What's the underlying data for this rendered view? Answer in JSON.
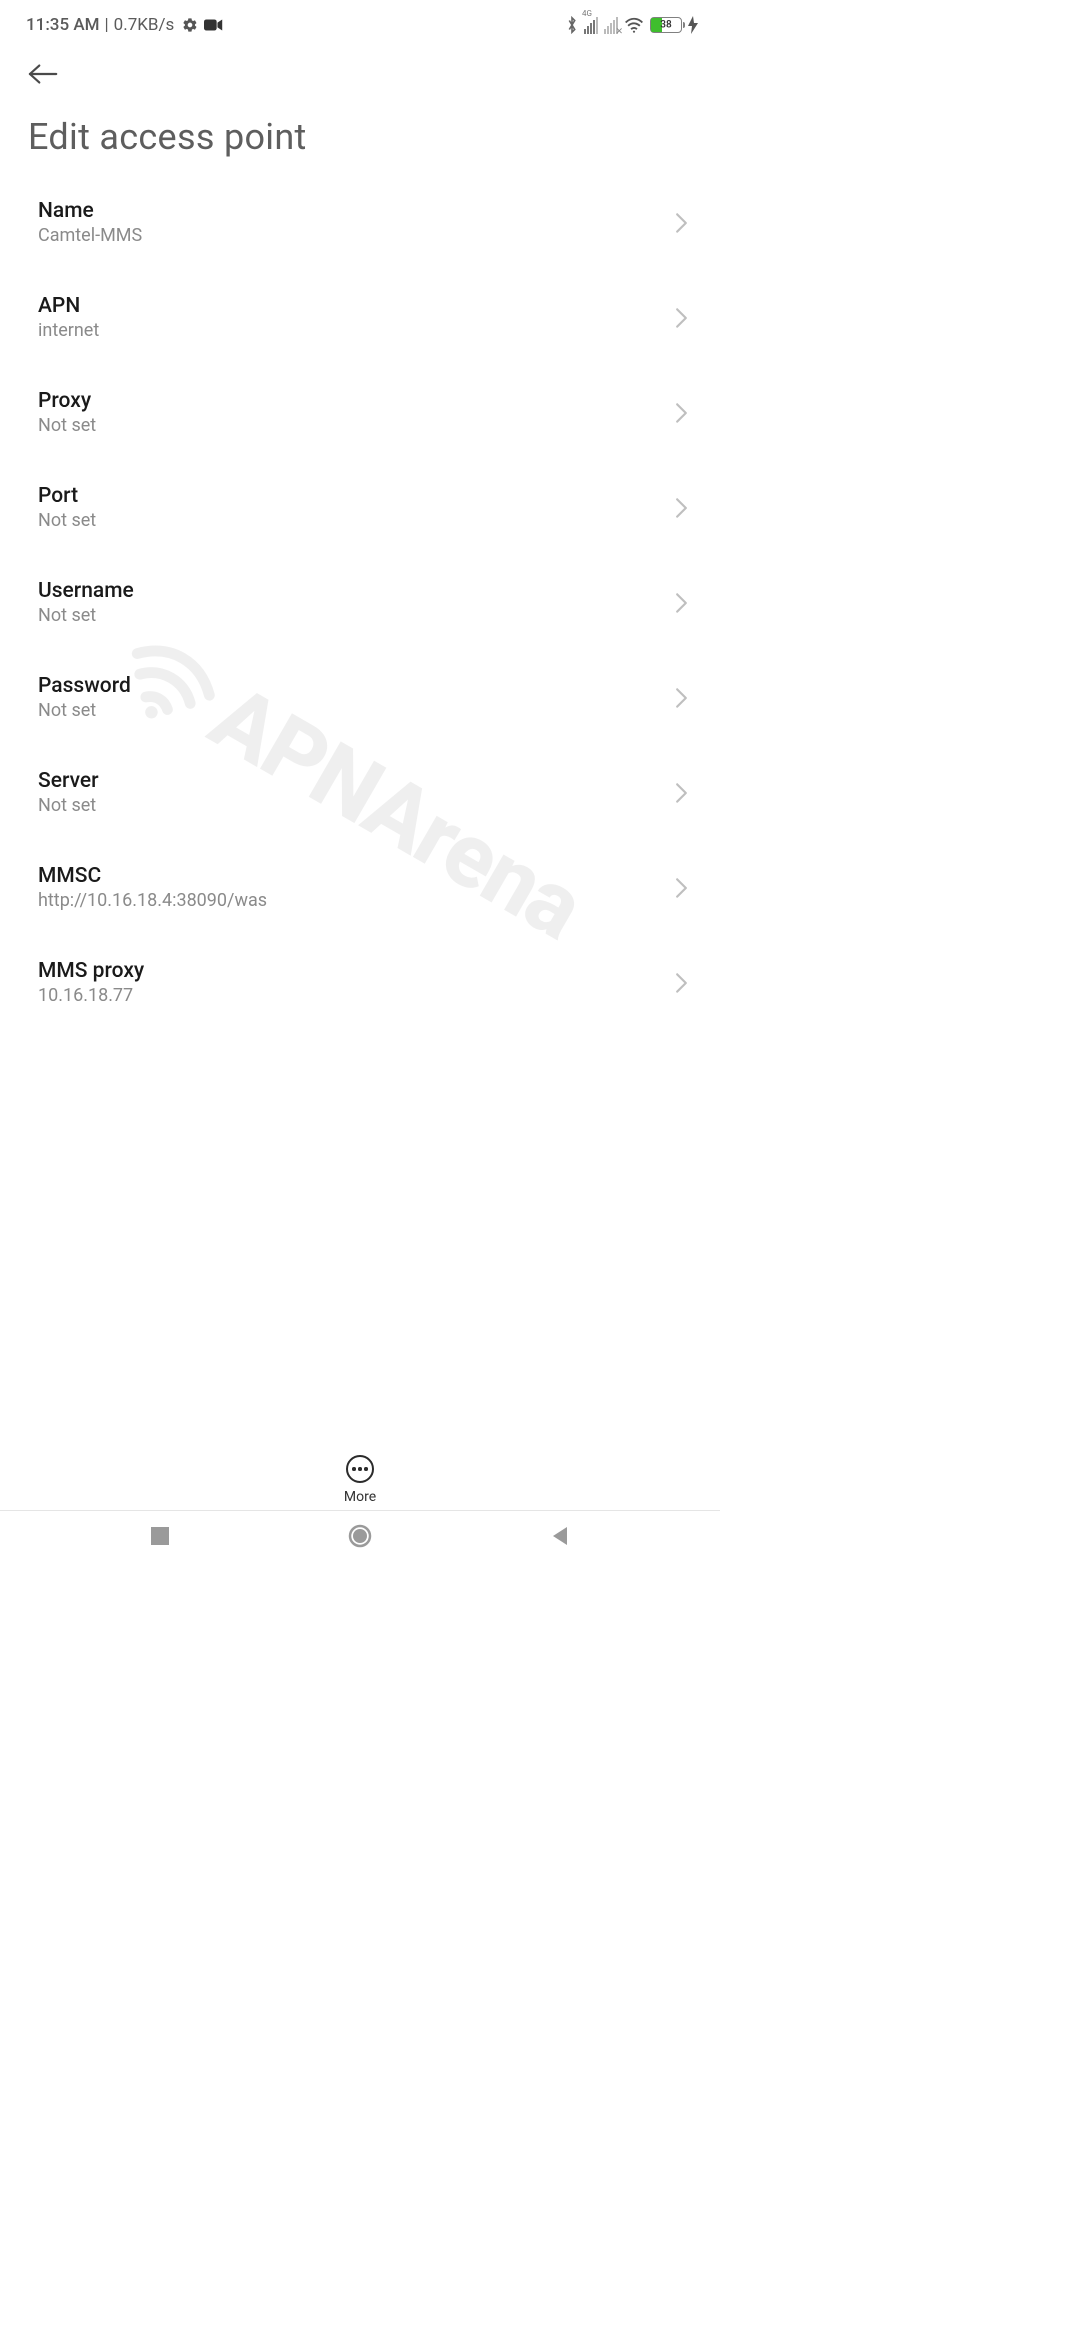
{
  "status": {
    "time": "11:35 AM",
    "speed": "0.7KB/s",
    "signal_tag": "4G",
    "battery_percent": "38"
  },
  "header": {
    "title": "Edit access point"
  },
  "settings": [
    {
      "label": "Name",
      "value": "Camtel-MMS"
    },
    {
      "label": "APN",
      "value": "internet"
    },
    {
      "label": "Proxy",
      "value": "Not set"
    },
    {
      "label": "Port",
      "value": "Not set"
    },
    {
      "label": "Username",
      "value": "Not set"
    },
    {
      "label": "Password",
      "value": "Not set"
    },
    {
      "label": "Server",
      "value": "Not set"
    },
    {
      "label": "MMSC",
      "value": "http://10.16.18.4:38090/was"
    },
    {
      "label": "MMS proxy",
      "value": "10.16.18.77"
    }
  ],
  "bottom_action": {
    "label": "More"
  },
  "watermark": {
    "text": "APNArena"
  }
}
